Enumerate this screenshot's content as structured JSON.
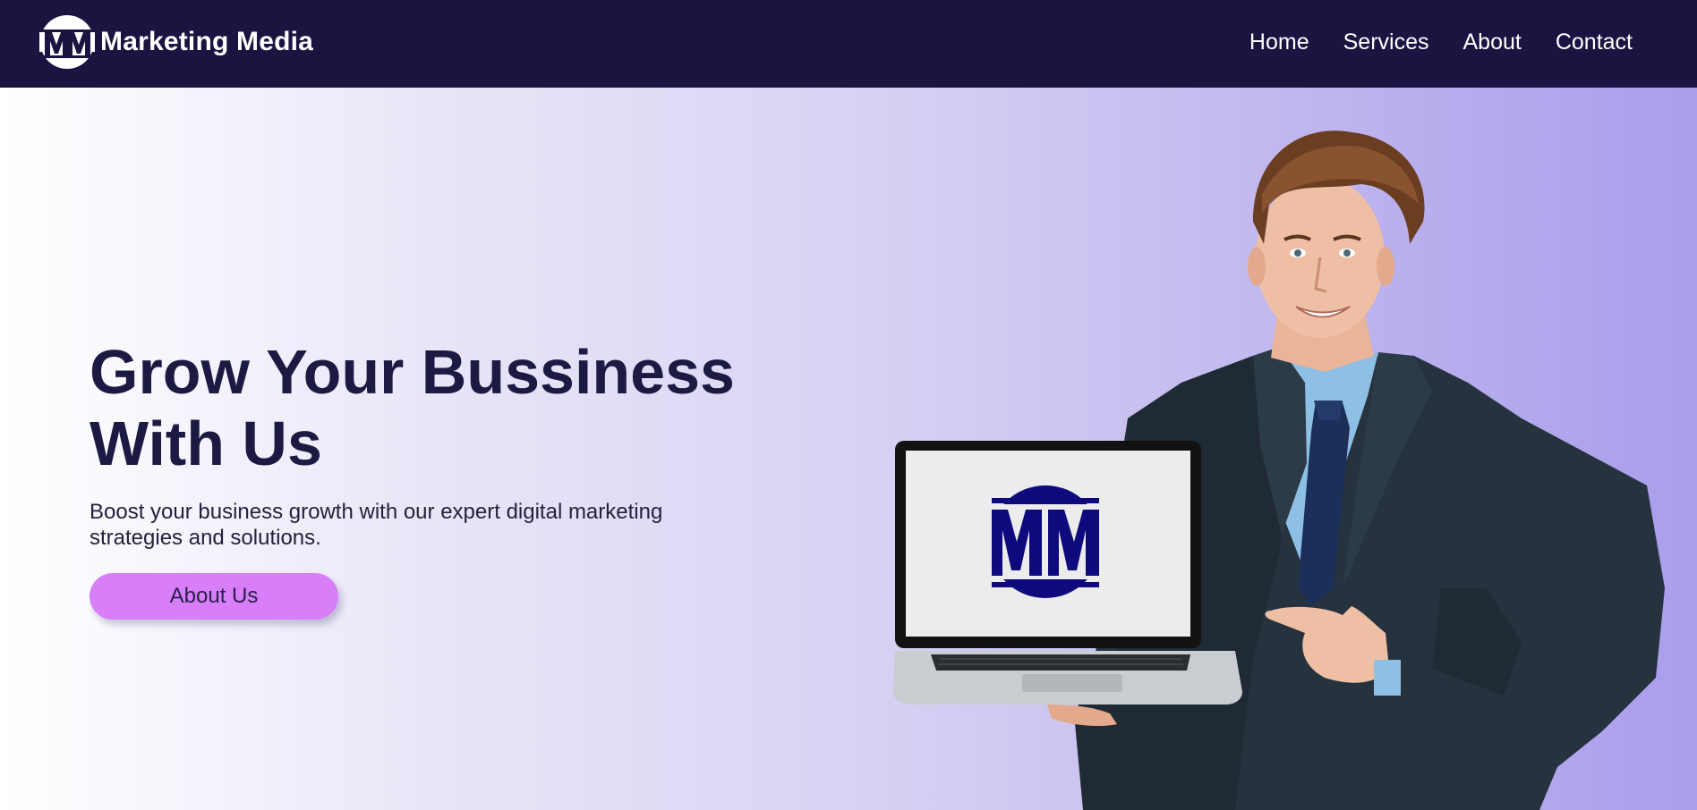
{
  "brand": {
    "logo_text": "MM",
    "name": "Marketing Media"
  },
  "nav": {
    "links": [
      {
        "label": "Home"
      },
      {
        "label": "Services"
      },
      {
        "label": "About"
      },
      {
        "label": "Contact"
      }
    ]
  },
  "hero": {
    "title": "Grow Your Bussiness With Us",
    "subtitle": "Boost your business growth with our expert digital marketing strategies and solutions.",
    "cta_label": "About Us",
    "screen_logo_text": "MM"
  },
  "colors": {
    "nav_bg": "#191540",
    "title": "#1c1942",
    "cta_bg": "#d77ef8",
    "logo_navy": "#0e0a7e"
  },
  "icons": {
    "brand_logo": "mm-circle-logo-icon"
  }
}
